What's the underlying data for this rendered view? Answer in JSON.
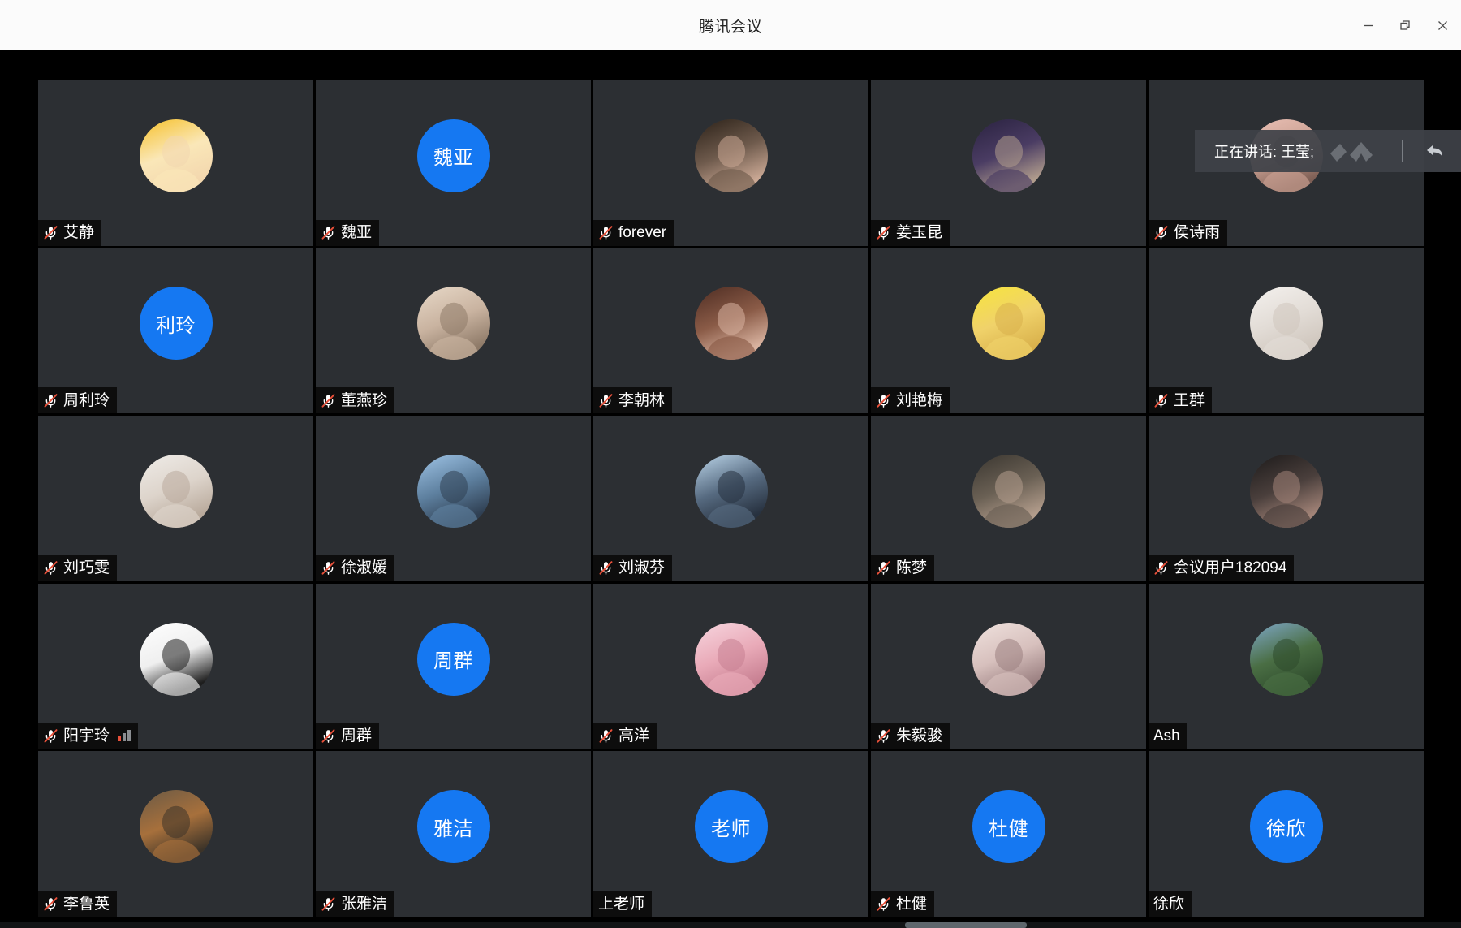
{
  "window": {
    "title": "腾讯会议",
    "controls": [
      {
        "name": "minimize",
        "glyph": "minimize-icon"
      },
      {
        "name": "restore",
        "glyph": "restore-icon"
      },
      {
        "name": "close",
        "glyph": "close-icon"
      }
    ]
  },
  "toast": {
    "text": "正在讲话: 王莹;",
    "wave_icon": "audio-wave-icon",
    "back_icon": "back-arrow-icon"
  },
  "colors": {
    "accent_blue": "#1578f2",
    "tile_bg": "#2c2f33",
    "stage_bg": "#000000",
    "titlebar_bg": "#fbfbfb",
    "nameplate_bg": "#0d0d0d",
    "mic_mute_red": "#e8503a",
    "toast_bg": "#3e4248"
  },
  "grid": {
    "columns": 5,
    "rows": 5,
    "participants": [
      {
        "name": "艾静",
        "muted": true,
        "avatar": "photo",
        "photo": "baby-yellow-hat",
        "signal": false
      },
      {
        "name": "魏亚",
        "muted": true,
        "avatar": "initials",
        "initials": "魏亚",
        "signal": false
      },
      {
        "name": "forever",
        "muted": true,
        "avatar": "photo",
        "photo": "woman-dark-hair",
        "signal": false
      },
      {
        "name": "姜玉昆",
        "muted": true,
        "avatar": "photo",
        "photo": "purple-portrait",
        "signal": false
      },
      {
        "name": "侯诗雨",
        "muted": true,
        "avatar": "photo",
        "photo": "pink-portrait",
        "signal": false
      },
      {
        "name": "周利玲",
        "muted": true,
        "avatar": "initials",
        "initials": "利玲",
        "signal": false
      },
      {
        "name": "董燕珍",
        "muted": true,
        "avatar": "photo",
        "photo": "child-drink",
        "signal": false
      },
      {
        "name": "李朝林",
        "muted": true,
        "avatar": "photo",
        "photo": "woman-phone",
        "signal": false
      },
      {
        "name": "刘艳梅",
        "muted": true,
        "avatar": "photo",
        "photo": "yellow-cartoon",
        "signal": false
      },
      {
        "name": "王群",
        "muted": true,
        "avatar": "photo",
        "photo": "white-rabbit",
        "signal": false
      },
      {
        "name": "刘巧雯",
        "muted": true,
        "avatar": "photo",
        "photo": "white-dog",
        "signal": false
      },
      {
        "name": "徐淑媛",
        "muted": true,
        "avatar": "photo",
        "photo": "anime-girl",
        "signal": false
      },
      {
        "name": "刘淑芬",
        "muted": true,
        "avatar": "photo",
        "photo": "winter-person",
        "signal": false
      },
      {
        "name": "陈梦",
        "muted": true,
        "avatar": "photo",
        "photo": "bucket-hat",
        "signal": false
      },
      {
        "name": "会议用户182094",
        "muted": true,
        "avatar": "photo",
        "photo": "dark-portrait",
        "signal": false
      },
      {
        "name": "阳宇玲",
        "muted": true,
        "avatar": "photo",
        "photo": "white-sketch",
        "signal": true
      },
      {
        "name": "周群",
        "muted": true,
        "avatar": "initials",
        "initials": "周群",
        "signal": false
      },
      {
        "name": "高洋",
        "muted": true,
        "avatar": "photo",
        "photo": "pink-cartoon",
        "signal": false
      },
      {
        "name": "朱毅骏",
        "muted": true,
        "avatar": "photo",
        "photo": "anime-pale",
        "signal": false
      },
      {
        "name": "Ash",
        "muted": false,
        "avatar": "photo",
        "photo": "landscape-person",
        "signal": false
      },
      {
        "name": "李鲁英",
        "muted": true,
        "avatar": "photo",
        "photo": "indoor-room",
        "signal": false
      },
      {
        "name": "张雅洁",
        "muted": true,
        "avatar": "initials",
        "initials": "雅洁",
        "signal": false
      },
      {
        "name": "上老师",
        "muted": false,
        "avatar": "initials",
        "initials": "老师",
        "signal": false
      },
      {
        "name": "杜健",
        "muted": true,
        "avatar": "initials",
        "initials": "杜健",
        "signal": false
      },
      {
        "name": "徐欣",
        "muted": false,
        "avatar": "initials",
        "initials": "徐欣",
        "signal": false
      }
    ]
  }
}
